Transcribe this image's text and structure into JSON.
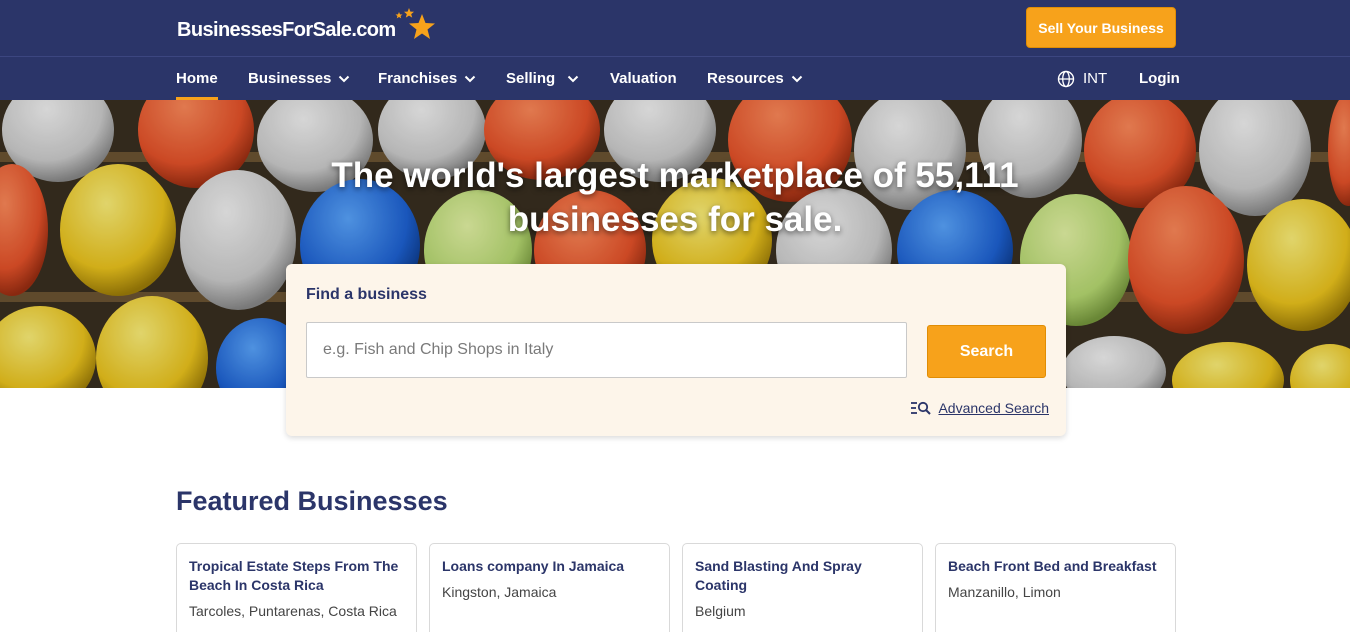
{
  "header": {
    "logo_text": "BusinessesForSale.com",
    "sell_button": "Sell Your Business"
  },
  "nav": {
    "items": [
      {
        "label": "Home",
        "active": true
      },
      {
        "label": "Businesses",
        "dropdown": true
      },
      {
        "label": "Franchises",
        "dropdown": true
      },
      {
        "label": "Selling",
        "dropdown": true
      },
      {
        "label": "Valuation"
      },
      {
        "label": "Resources",
        "dropdown": true
      }
    ],
    "region": "INT",
    "login": "Login"
  },
  "hero": {
    "title_line1": "The world's largest marketplace of 55,111",
    "title_line2": "businesses for sale."
  },
  "search": {
    "label": "Find a business",
    "placeholder": "e.g. Fish and Chip Shops in Italy",
    "button": "Search",
    "advanced": "Advanced Search"
  },
  "featured": {
    "title": "Featured Businesses",
    "cards": [
      {
        "title": "Tropical Estate Steps From The Beach In Costa Rica",
        "location": "Tarcoles, Puntarenas, Costa Rica"
      },
      {
        "title": "Loans company In Jamaica",
        "location": "Kingston, Jamaica"
      },
      {
        "title": "Sand Blasting And Spray Coating",
        "location": "Belgium"
      },
      {
        "title": "Beach Front Bed and Breakfast",
        "location": "Manzanillo, Limon"
      }
    ]
  },
  "colors": {
    "navy": "#2b3569",
    "accent_orange": "#f7a21b",
    "search_card_bg": "#fdf5ea"
  },
  "icons": [
    "star-icon",
    "chevron-down-icon",
    "globe-icon",
    "advanced-search-icon"
  ]
}
